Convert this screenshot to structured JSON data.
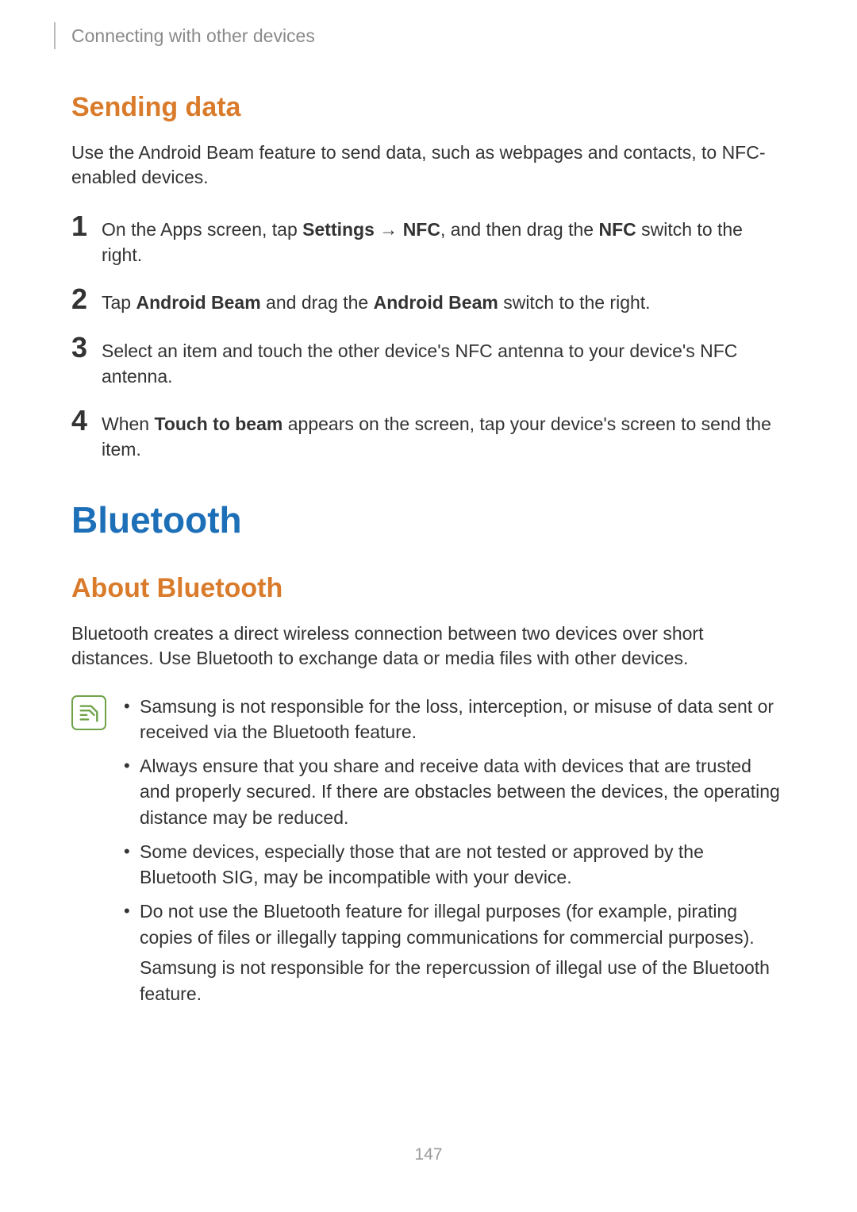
{
  "breadcrumb": "Connecting with other devices",
  "sending_data": {
    "title": "Sending data",
    "intro": "Use the Android Beam feature to send data, such as webpages and contacts, to NFC-enabled devices.",
    "steps": [
      {
        "num": "1",
        "parts": [
          "On the Apps screen, tap ",
          "Settings",
          " → ",
          "NFC",
          ", and then drag the ",
          "NFC",
          " switch to the right."
        ]
      },
      {
        "num": "2",
        "parts": [
          "Tap ",
          "Android Beam",
          " and drag the ",
          "Android Beam",
          " switch to the right."
        ]
      },
      {
        "num": "3",
        "parts": [
          "Select an item and touch the other device's NFC antenna to your device's NFC antenna."
        ]
      },
      {
        "num": "4",
        "parts": [
          "When ",
          "Touch to beam",
          " appears on the screen, tap your device's screen to send the item."
        ]
      }
    ]
  },
  "bluetooth": {
    "title": "Bluetooth",
    "about_title": "About Bluetooth",
    "about_body": "Bluetooth creates a direct wireless connection between two devices over short distances. Use Bluetooth to exchange data or media files with other devices.",
    "notes": [
      "Samsung is not responsible for the loss, interception, or misuse of data sent or received via the Bluetooth feature.",
      "Always ensure that you share and receive data with devices that are trusted and properly secured. If there are obstacles between the devices, the operating distance may be reduced.",
      "Some devices, especially those that are not tested or approved by the Bluetooth SIG, may be incompatible with your device.",
      "Do not use the Bluetooth feature for illegal purposes (for example, pirating copies of files or illegally tapping communications for commercial purposes)."
    ],
    "note_extra": "Samsung is not responsible for the repercussion of illegal use of the Bluetooth feature."
  },
  "page_number": "147"
}
